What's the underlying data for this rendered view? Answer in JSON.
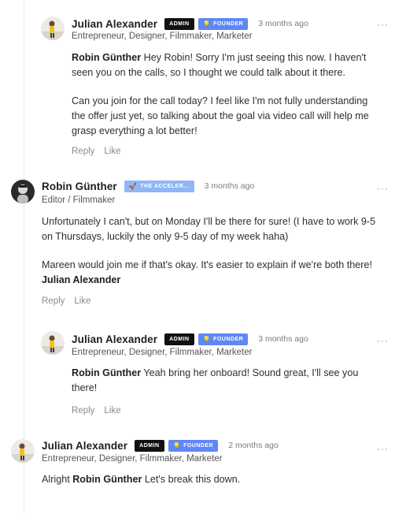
{
  "comments": [
    {
      "author": "Julian Alexander",
      "badges": {
        "admin": "ADMIN",
        "founder": "FOUNDER"
      },
      "time": "3 months ago",
      "subtitle": "Entrepreneur, Designer, Filmmaker, Marketer",
      "p1_mention": "Robin Günther",
      "p1_text": " Hey Robin! Sorry I'm just seeing this now. I haven't seen you on the calls, so I thought we could talk about it there.",
      "p2_text": "Can you join for the call today? I feel like I'm not fully understanding the offer just yet, so talking about the goal via video call will help me grasp everything a lot better!",
      "reply": "Reply",
      "like": "Like",
      "more": "···"
    },
    {
      "author": "Robin Günther",
      "badge": "THE ACCELER...",
      "time": "3 months ago",
      "subtitle": "Editor / Filmmaker",
      "p1_text": "Unfortunately I can't, but on Monday I'll be there for sure! (I have to work 9-5 on Thursdays, luckily the only 9-5 day of my week haha)",
      "p2_text": "Mareen would join me if that's okay. It's easier to explain if we're both there!  ",
      "p2_mention": "Julian Alexander",
      "reply": "Reply",
      "like": "Like",
      "more": "···"
    },
    {
      "author": "Julian Alexander",
      "badges": {
        "admin": "ADMIN",
        "founder": "FOUNDER"
      },
      "time": "3 months ago",
      "subtitle": "Entrepreneur, Designer, Filmmaker, Marketer",
      "p1_mention": "Robin Günther",
      "p1_text": " Yeah bring her onboard! Sound great, I'll see you there!",
      "reply": "Reply",
      "like": "Like",
      "more": "···"
    },
    {
      "author": "Julian Alexander",
      "badges": {
        "admin": "ADMIN",
        "founder": "FOUNDER"
      },
      "time": "2 months ago",
      "subtitle": "Entrepreneur, Designer, Filmmaker, Marketer",
      "p1_prefix": "Alright ",
      "p1_mention": "Robin Günther",
      "p1_text": " Let's break this down.",
      "more": "···"
    }
  ]
}
